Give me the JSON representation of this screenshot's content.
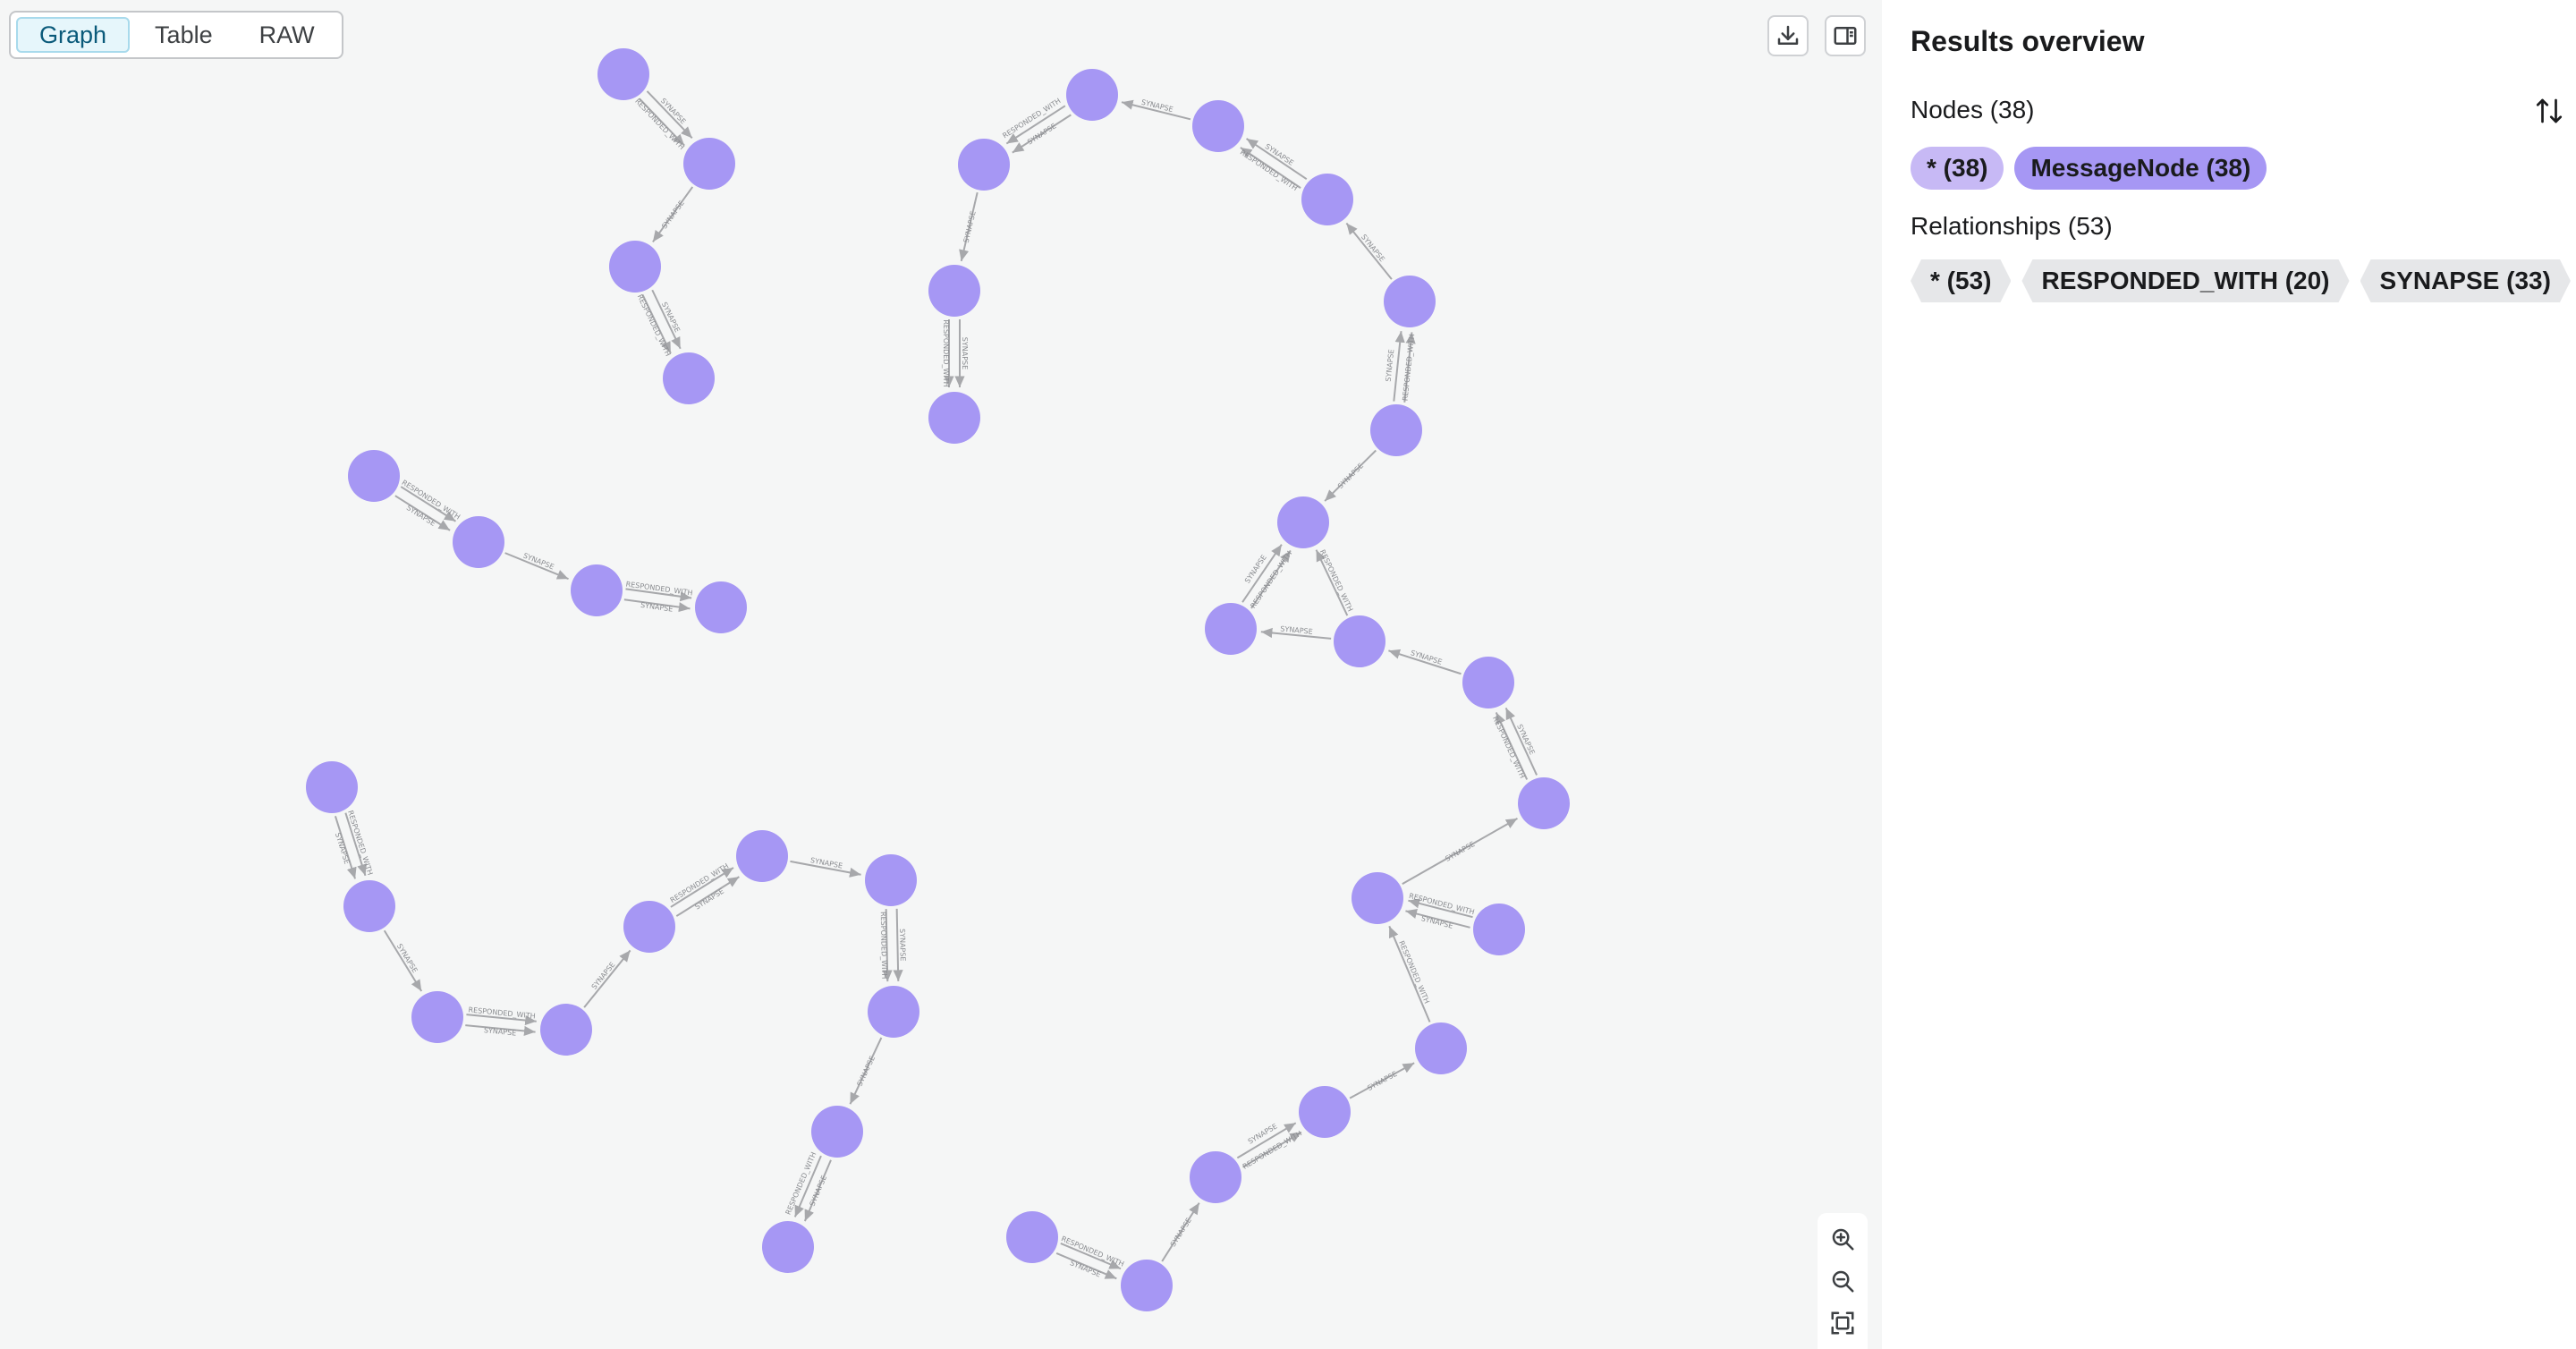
{
  "view_switch": {
    "tabs": [
      {
        "label": "Graph",
        "active": true
      },
      {
        "label": "Table",
        "active": false
      },
      {
        "label": "RAW",
        "active": false
      }
    ]
  },
  "canvas": {
    "node_color": "#a697f4",
    "relationship_color": "#a7a8ab",
    "icons": {
      "download": "download-icon",
      "panel_toggle": "side-panel-icon",
      "zoom_in": "zoom-in-icon",
      "zoom_out": "zoom-out-icon",
      "fit": "fit-to-screen-icon"
    }
  },
  "results": {
    "title": "Results overview",
    "nodes_heading": "Nodes (38)",
    "node_badges": [
      {
        "label": "* (38)",
        "color": "#c7b9f5"
      },
      {
        "label": "MessageNode (38)",
        "color": "#a697f4"
      }
    ],
    "relationships_heading": "Relationships (53)",
    "relationship_badges": [
      {
        "label": "* (53)"
      },
      {
        "label": "RESPONDED_WITH (20)"
      },
      {
        "label": "SYNAPSE (33)"
      }
    ]
  }
}
